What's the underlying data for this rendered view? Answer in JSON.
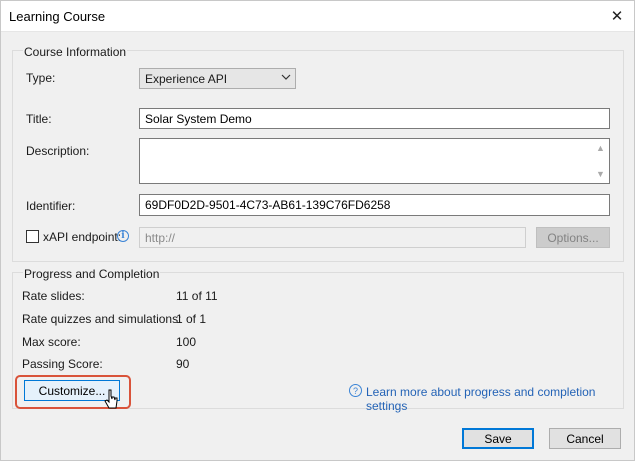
{
  "window": {
    "title": "Learning Course",
    "close_glyph": "✕"
  },
  "course_info": {
    "legend": "Course Information",
    "type_label": "Type:",
    "type_value": "Experience API",
    "title_label": "Title:",
    "title_value": "Solar System Demo",
    "description_label": "Description:",
    "description_value": "",
    "identifier_label": "Identifier:",
    "identifier_value": "69DF0D2D-9501-4C73-AB61-139C76FD6258",
    "xapi_label": "xAPI endpoint:",
    "xapi_checked": false,
    "xapi_placeholder": "http://",
    "options_label": "Options..."
  },
  "progress": {
    "legend": "Progress and Completion",
    "rows": [
      {
        "label": "Rate slides:",
        "value": "11 of 11"
      },
      {
        "label": "Rate quizzes and simulations:",
        "value": "1 of 1"
      },
      {
        "label": "Max score:",
        "value": "100"
      },
      {
        "label": "Passing Score:",
        "value": "90"
      }
    ],
    "customize_label": "Customize...",
    "help_link": "Learn more about progress and completion settings"
  },
  "footer": {
    "save_label": "Save",
    "cancel_label": "Cancel"
  },
  "colors": {
    "highlight": "#d9533a",
    "link": "#2463b6",
    "accent": "#0078d7"
  },
  "icons": {
    "info": "info-icon",
    "help": "question-circle-icon",
    "caret": "chevron-down-icon",
    "cursor": "mouse-pointer-icon"
  }
}
